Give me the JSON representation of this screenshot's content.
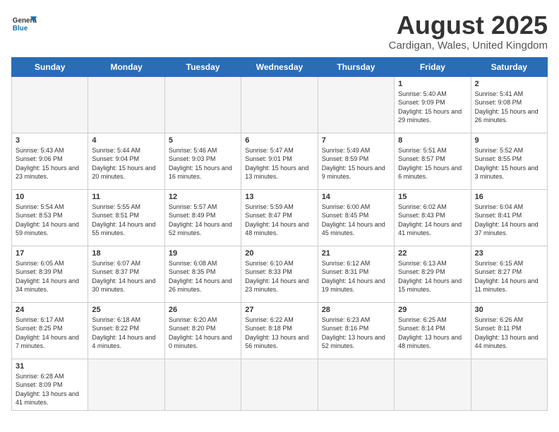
{
  "logo": {
    "text_general": "General",
    "text_blue": "Blue"
  },
  "title": "August 2025",
  "subtitle": "Cardigan, Wales, United Kingdom",
  "days_of_week": [
    "Sunday",
    "Monday",
    "Tuesday",
    "Wednesday",
    "Thursday",
    "Friday",
    "Saturday"
  ],
  "weeks": [
    [
      {
        "day": "",
        "empty": true
      },
      {
        "day": "",
        "empty": true
      },
      {
        "day": "",
        "empty": true
      },
      {
        "day": "",
        "empty": true
      },
      {
        "day": "",
        "empty": true
      },
      {
        "day": "1",
        "info": "Sunrise: 5:40 AM\nSunset: 9:09 PM\nDaylight: 15 hours and 29 minutes."
      },
      {
        "day": "2",
        "info": "Sunrise: 5:41 AM\nSunset: 9:08 PM\nDaylight: 15 hours and 26 minutes."
      }
    ],
    [
      {
        "day": "3",
        "info": "Sunrise: 5:43 AM\nSunset: 9:06 PM\nDaylight: 15 hours and 23 minutes."
      },
      {
        "day": "4",
        "info": "Sunrise: 5:44 AM\nSunset: 9:04 PM\nDaylight: 15 hours and 20 minutes."
      },
      {
        "day": "5",
        "info": "Sunrise: 5:46 AM\nSunset: 9:03 PM\nDaylight: 15 hours and 16 minutes."
      },
      {
        "day": "6",
        "info": "Sunrise: 5:47 AM\nSunset: 9:01 PM\nDaylight: 15 hours and 13 minutes."
      },
      {
        "day": "7",
        "info": "Sunrise: 5:49 AM\nSunset: 8:59 PM\nDaylight: 15 hours and 9 minutes."
      },
      {
        "day": "8",
        "info": "Sunrise: 5:51 AM\nSunset: 8:57 PM\nDaylight: 15 hours and 6 minutes."
      },
      {
        "day": "9",
        "info": "Sunrise: 5:52 AM\nSunset: 8:55 PM\nDaylight: 15 hours and 3 minutes."
      }
    ],
    [
      {
        "day": "10",
        "info": "Sunrise: 5:54 AM\nSunset: 8:53 PM\nDaylight: 14 hours and 59 minutes."
      },
      {
        "day": "11",
        "info": "Sunrise: 5:55 AM\nSunset: 8:51 PM\nDaylight: 14 hours and 55 minutes."
      },
      {
        "day": "12",
        "info": "Sunrise: 5:57 AM\nSunset: 8:49 PM\nDaylight: 14 hours and 52 minutes."
      },
      {
        "day": "13",
        "info": "Sunrise: 5:59 AM\nSunset: 8:47 PM\nDaylight: 14 hours and 48 minutes."
      },
      {
        "day": "14",
        "info": "Sunrise: 6:00 AM\nSunset: 8:45 PM\nDaylight: 14 hours and 45 minutes."
      },
      {
        "day": "15",
        "info": "Sunrise: 6:02 AM\nSunset: 8:43 PM\nDaylight: 14 hours and 41 minutes."
      },
      {
        "day": "16",
        "info": "Sunrise: 6:04 AM\nSunset: 8:41 PM\nDaylight: 14 hours and 37 minutes."
      }
    ],
    [
      {
        "day": "17",
        "info": "Sunrise: 6:05 AM\nSunset: 8:39 PM\nDaylight: 14 hours and 34 minutes."
      },
      {
        "day": "18",
        "info": "Sunrise: 6:07 AM\nSunset: 8:37 PM\nDaylight: 14 hours and 30 minutes."
      },
      {
        "day": "19",
        "info": "Sunrise: 6:08 AM\nSunset: 8:35 PM\nDaylight: 14 hours and 26 minutes."
      },
      {
        "day": "20",
        "info": "Sunrise: 6:10 AM\nSunset: 8:33 PM\nDaylight: 14 hours and 23 minutes."
      },
      {
        "day": "21",
        "info": "Sunrise: 6:12 AM\nSunset: 8:31 PM\nDaylight: 14 hours and 19 minutes."
      },
      {
        "day": "22",
        "info": "Sunrise: 6:13 AM\nSunset: 8:29 PM\nDaylight: 14 hours and 15 minutes."
      },
      {
        "day": "23",
        "info": "Sunrise: 6:15 AM\nSunset: 8:27 PM\nDaylight: 14 hours and 11 minutes."
      }
    ],
    [
      {
        "day": "24",
        "info": "Sunrise: 6:17 AM\nSunset: 8:25 PM\nDaylight: 14 hours and 7 minutes."
      },
      {
        "day": "25",
        "info": "Sunrise: 6:18 AM\nSunset: 8:22 PM\nDaylight: 14 hours and 4 minutes."
      },
      {
        "day": "26",
        "info": "Sunrise: 6:20 AM\nSunset: 8:20 PM\nDaylight: 14 hours and 0 minutes."
      },
      {
        "day": "27",
        "info": "Sunrise: 6:22 AM\nSunset: 8:18 PM\nDaylight: 13 hours and 56 minutes."
      },
      {
        "day": "28",
        "info": "Sunrise: 6:23 AM\nSunset: 8:16 PM\nDaylight: 13 hours and 52 minutes."
      },
      {
        "day": "29",
        "info": "Sunrise: 6:25 AM\nSunset: 8:14 PM\nDaylight: 13 hours and 48 minutes."
      },
      {
        "day": "30",
        "info": "Sunrise: 6:26 AM\nSunset: 8:11 PM\nDaylight: 13 hours and 44 minutes."
      }
    ],
    [
      {
        "day": "31",
        "info": "Sunrise: 6:28 AM\nSunset: 8:09 PM\nDaylight: 13 hours and 41 minutes."
      },
      {
        "day": "",
        "empty": true
      },
      {
        "day": "",
        "empty": true
      },
      {
        "day": "",
        "empty": true
      },
      {
        "day": "",
        "empty": true
      },
      {
        "day": "",
        "empty": true
      },
      {
        "day": "",
        "empty": true
      }
    ]
  ]
}
